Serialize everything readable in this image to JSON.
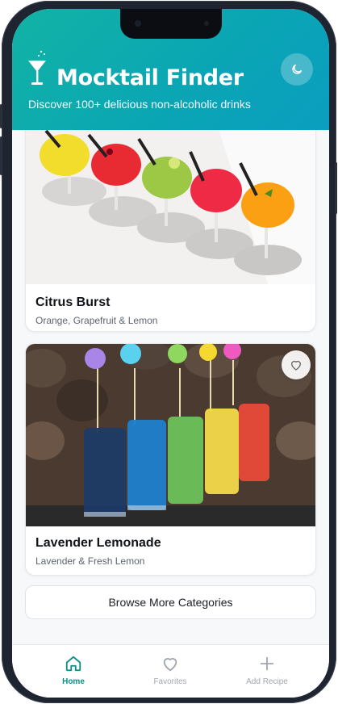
{
  "header": {
    "title": "Mocktail Finder",
    "subtitle": "Discover 100+ delicious non-alcoholic drinks",
    "logo_icon": "cocktail-glass-icon",
    "theme_icon": "moon-icon"
  },
  "cards": [
    {
      "name": "Citrus Burst",
      "description": "Orange, Grapefruit & Lemon",
      "image": "colorful-citrus-cocktails-photo"
    },
    {
      "name": "Lavender Lemonade",
      "description": "Lavender & Fresh Lemon",
      "image": "rainbow-lemonade-glasses-photo"
    }
  ],
  "browse_button": "Browse More Categories",
  "tabs": [
    {
      "label": "Home",
      "icon": "home-icon",
      "active": true
    },
    {
      "label": "Favorites",
      "icon": "heart-icon",
      "active": false
    },
    {
      "label": "Add Recipe",
      "icon": "plus-icon",
      "active": false
    }
  ],
  "colors": {
    "accent": "#0b8f86",
    "header": "#12b3a5"
  }
}
